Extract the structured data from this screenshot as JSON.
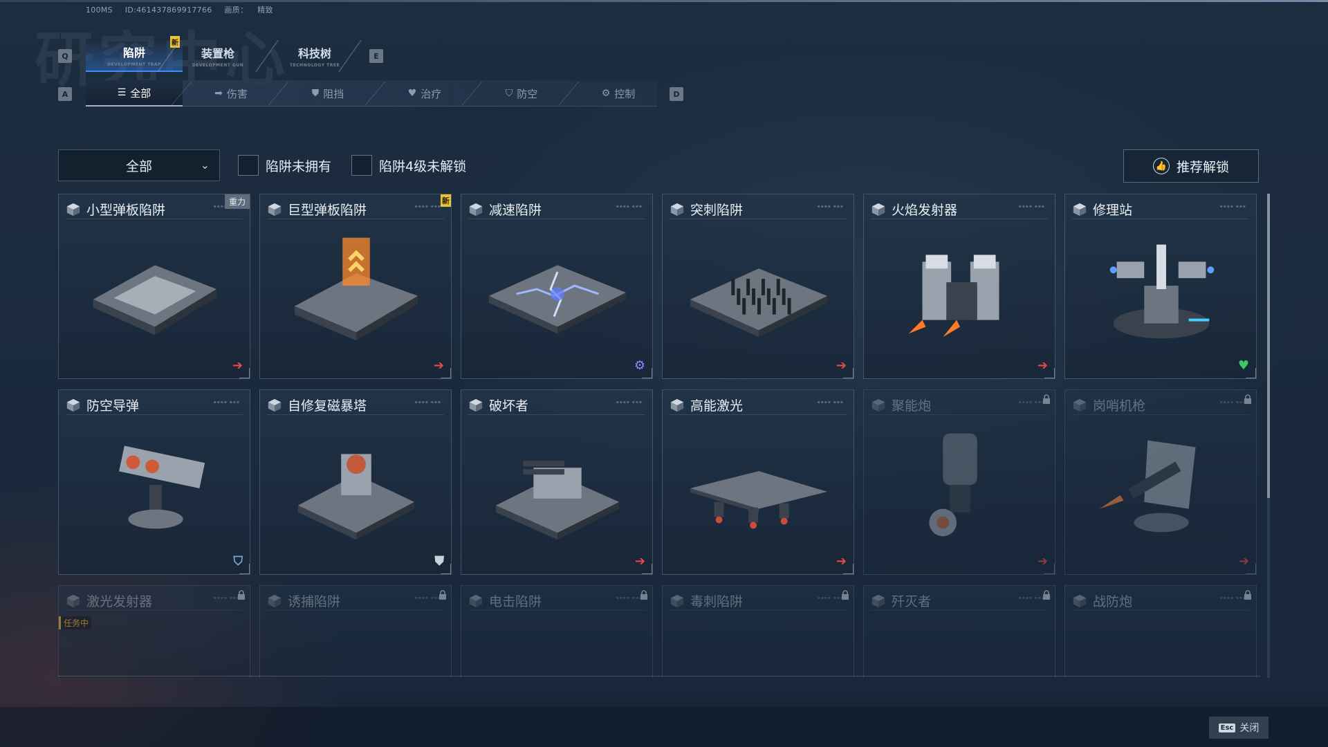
{
  "meta": {
    "latency": "100MS",
    "id": "ID:4614378699177​66",
    "quality_label": "画质：",
    "quality_value": "精致"
  },
  "bg_title": "研究中心",
  "keys": {
    "prev_main": "Q",
    "next_main": "E",
    "prev_sub": "A",
    "next_sub": "D"
  },
  "main_tabs": [
    {
      "label": "陷阱",
      "sub": "DEVELOPMENT TRAP",
      "active": true
    },
    {
      "label": "装置枪",
      "sub": "DEVELOPMENT GUN"
    },
    {
      "label": "科技树",
      "sub": "TECHNOLOGY TREE"
    }
  ],
  "new_badge": "新",
  "sub_tabs": [
    {
      "label": "全部",
      "icon": "list-icon",
      "glyph": "☰"
    },
    {
      "label": "伤害",
      "icon": "damage-arrow-icon",
      "glyph": "➡"
    },
    {
      "label": "阻挡",
      "icon": "block-shield-icon",
      "glyph": "⛊"
    },
    {
      "label": "治疗",
      "icon": "heal-heart-icon",
      "glyph": "♥"
    },
    {
      "label": "防空",
      "icon": "anti-air-icon",
      "glyph": "⛉"
    },
    {
      "label": "控制",
      "icon": "control-gear-icon",
      "glyph": "⚙"
    }
  ],
  "filter": {
    "dropdown_value": "全部",
    "check1_label": "陷阱未拥有",
    "check2_label": "陷阱4级未解锁",
    "recommend_label": "推荐解锁"
  },
  "colors": {
    "accent": "#3f8cff",
    "new": "#e8c23a",
    "damage": "#e84a4a",
    "control": "#8b8cff",
    "heal": "#3fc46a"
  },
  "cards": [
    {
      "name": "小型弹板陷阱",
      "tag": "重力",
      "type": "damage",
      "glyph": "➔",
      "art": "plate"
    },
    {
      "name": "巨型弹板陷阱",
      "tag_new": "新",
      "type": "damage",
      "glyph": "➔",
      "art": "plate-fire"
    },
    {
      "name": "减速陷阱",
      "type": "control",
      "glyph": "⚙",
      "art": "electric"
    },
    {
      "name": "突刺陷阱",
      "type": "damage",
      "glyph": "➔",
      "art": "spikes"
    },
    {
      "name": "火焰发射器",
      "type": "damage",
      "glyph": "➔",
      "art": "flamer"
    },
    {
      "name": "修理站",
      "type": "heal",
      "glyph": "♥",
      "art": "repair"
    },
    {
      "name": "防空导弹",
      "type": "anti-air",
      "glyph": "⛉",
      "art": "missile"
    },
    {
      "name": "自修复磁暴塔",
      "type": "block",
      "glyph": "⛊",
      "art": "tesla"
    },
    {
      "name": "破坏者",
      "type": "damage",
      "glyph": "➔",
      "art": "destroyer"
    },
    {
      "name": "高能激光",
      "type": "damage",
      "glyph": "➔",
      "art": "laser"
    },
    {
      "name": "聚能炮",
      "type": "damage",
      "glyph": "➔",
      "locked": true,
      "art": "cannon"
    },
    {
      "name": "岗哨机枪",
      "type": "damage",
      "glyph": "➔",
      "locked": true,
      "art": "sentry"
    },
    {
      "name": "激光发射器",
      "locked": true,
      "partial": true,
      "mission": "任务中"
    },
    {
      "name": "诱捕陷阱",
      "locked": true,
      "partial": true
    },
    {
      "name": "电击陷阱",
      "locked": true,
      "partial": true
    },
    {
      "name": "毒刺陷阱",
      "locked": true,
      "partial": true
    },
    {
      "name": "歼灭者",
      "locked": true,
      "partial": true
    },
    {
      "name": "战防炮",
      "locked": true,
      "partial": true
    }
  ],
  "footer": {
    "esc_key": "Esc",
    "close_label": "关闭"
  }
}
